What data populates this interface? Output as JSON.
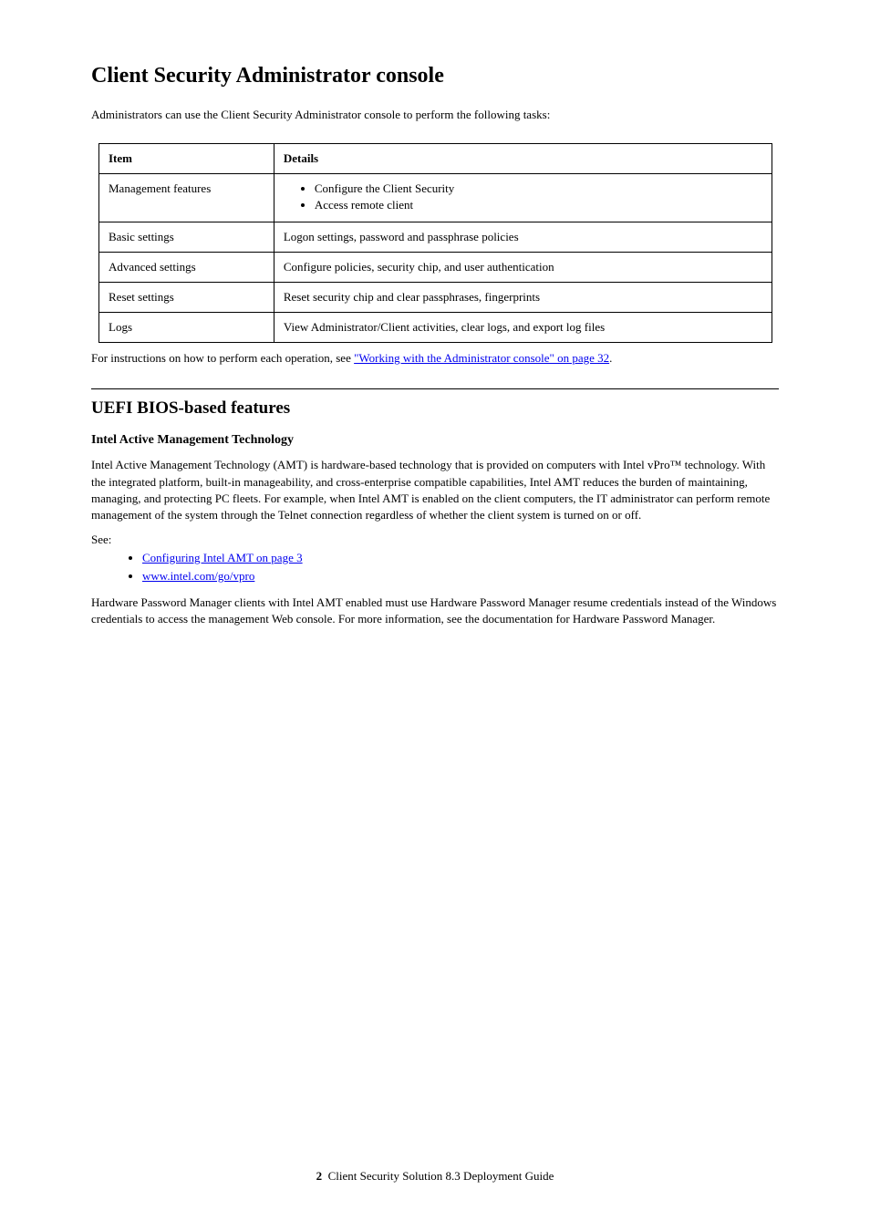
{
  "heading": "Client Security Administrator console",
  "intro": "Administrators can use the Client Security Administrator console to perform the following tasks:",
  "table": {
    "headers": [
      "Item",
      "Details"
    ],
    "rows": [
      {
        "item": "Management features",
        "bullets": [
          "Configure the Client Security",
          "Access remote client"
        ]
      },
      {
        "item": "Basic settings",
        "details": "Logon settings, password and passphrase policies"
      },
      {
        "item": "Advanced settings",
        "details": "Configure policies, security chip, and user authentication"
      },
      {
        "item": "Reset settings",
        "details": "Reset security chip and clear passphrases, fingerprints"
      },
      {
        "item": "Logs",
        "details": "View Administrator/Client activities, clear logs, and export log files"
      }
    ]
  },
  "afterTable": {
    "prefix": "For instructions on how to perform each operation, see ",
    "link": "\"Working with the Administrator console\" on page 32",
    "suffix": "."
  },
  "section": {
    "heading": "UEFI BIOS-based features",
    "sub": "Intel Active Management Technology",
    "p1": "Intel Active Management Technology (AMT) is hardware-based technology that is provided on computers with Intel vPro™ technology. With the integrated platform, built-in manageability, and cross-enterprise compatible capabilities, Intel AMT reduces the burden of maintaining, managing, and protecting PC fleets. For example, when Intel AMT is enabled on the client computers, the IT administrator can perform remote management of the system through the Telnet connection regardless of whether the client system is turned on or off.",
    "see": "See:",
    "links": [
      "Configuring Intel AMT on page 3",
      "www.intel.com/go/vpro"
    ],
    "p2": "Hardware Password Manager clients with Intel AMT enabled must use Hardware Password Manager resume credentials instead of the Windows credentials to access the management Web console. For more information, see the documentation for Hardware Password Manager."
  },
  "pageNumber": "2",
  "pageLabel": "Client Security Solution 8.3 Deployment Guide"
}
